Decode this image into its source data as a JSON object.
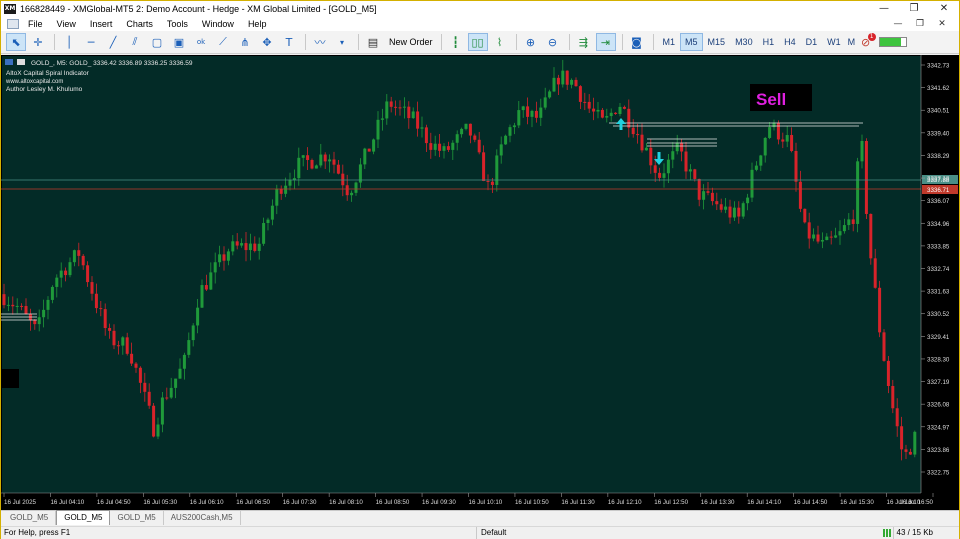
{
  "window": {
    "app_icon": "XM",
    "title": "166828449 - XMGlobal-MT5 2: Demo Account - Hedge - XM Global Limited - [GOLD_M5]",
    "controls": [
      "—",
      "❐",
      "✕"
    ]
  },
  "menu": {
    "items": [
      "File",
      "View",
      "Insert",
      "Charts",
      "Tools",
      "Window",
      "Help"
    ],
    "right_controls": [
      "—",
      "❐",
      "✕"
    ]
  },
  "toolbar": {
    "tools": [
      {
        "icon": "cursor-icon",
        "glyph": "⬉",
        "active": true
      },
      {
        "icon": "crosshair-icon",
        "glyph": "✛"
      },
      {
        "icon": "vertical-line-icon",
        "glyph": "│"
      },
      {
        "icon": "horizontal-line-icon",
        "glyph": "─"
      },
      {
        "icon": "trendline-icon",
        "glyph": "╱"
      },
      {
        "icon": "channel-icon",
        "glyph": "⫽"
      },
      {
        "icon": "shapes-icon",
        "glyph": "▢"
      },
      {
        "icon": "image-icon",
        "glyph": "▣"
      },
      {
        "icon": "label-icon",
        "glyph": "ok"
      },
      {
        "icon": "fibonacci-icon",
        "glyph": "⟋"
      },
      {
        "icon": "pitchfork-icon",
        "glyph": "⋔"
      },
      {
        "icon": "arrows-icon",
        "glyph": "✥"
      },
      {
        "icon": "text-tool-icon",
        "glyph": "T"
      }
    ],
    "new_order_label": "New Order",
    "timeframes": [
      "M1",
      "M5",
      "M15",
      "M30",
      "H1",
      "H4",
      "D1",
      "W1",
      "MN"
    ],
    "active_timeframe": "M5",
    "notification_count": "1"
  },
  "chart": {
    "symbol_line": "GOLD_, M5:  GOLD_   3336.42 3336.89 3336.25 3336.59",
    "indicator_name": "AltoX Capital Spiral Indicator",
    "indicator_site": "www.altoxcapital.com",
    "indicator_author": "Author Lesley M. Khulumo",
    "sell_label": "Sell",
    "bid_price": "3337.88",
    "ask_price": "3336.71",
    "price_axis": [
      "3342.73",
      "3341.62",
      "3340.51",
      "3339.40",
      "3338.29",
      "3337.18",
      "3336.07",
      "3334.96",
      "3333.85",
      "3332.74",
      "3331.63",
      "3330.52",
      "3329.41",
      "3328.30",
      "3327.19",
      "3326.08",
      "3324.97",
      "3323.86",
      "3322.75"
    ],
    "time_axis": [
      "16 Jul 2025",
      "16 Jul 04:10",
      "16 Jul 04:50",
      "16 Jul 05:30",
      "16 Jul 06:10",
      "16 Jul 06:50",
      "16 Jul 07:30",
      "16 Jul 08:10",
      "16 Jul 08:50",
      "16 Jul 09:30",
      "16 Jul 10:10",
      "16 Jul 10:50",
      "16 Jul 11:30",
      "16 Jul 12:10",
      "16 Jul 12:50",
      "16 Jul 13:30",
      "16 Jul 14:10",
      "16 Jul 14:50",
      "16 Jul 15:30",
      "16 Jul 16:10",
      "16 Jul 16:50"
    ],
    "colors": {
      "background": "#032b27",
      "bull": "#1f9a3a",
      "bear": "#d8232a",
      "bid_line": "#4a8f86",
      "ask_line": "#c0392b",
      "signal_arrow": "#22d3e0",
      "sell_text": "#e020e0"
    }
  },
  "tabs": {
    "items": [
      "GOLD_M5",
      "GOLD_M5",
      "GOLD_M5",
      "AUS200Cash,M5"
    ],
    "active_index": 1
  },
  "status": {
    "help": "For Help, press F1",
    "profile": "Default",
    "traffic": "43 / 15 Kb"
  }
}
